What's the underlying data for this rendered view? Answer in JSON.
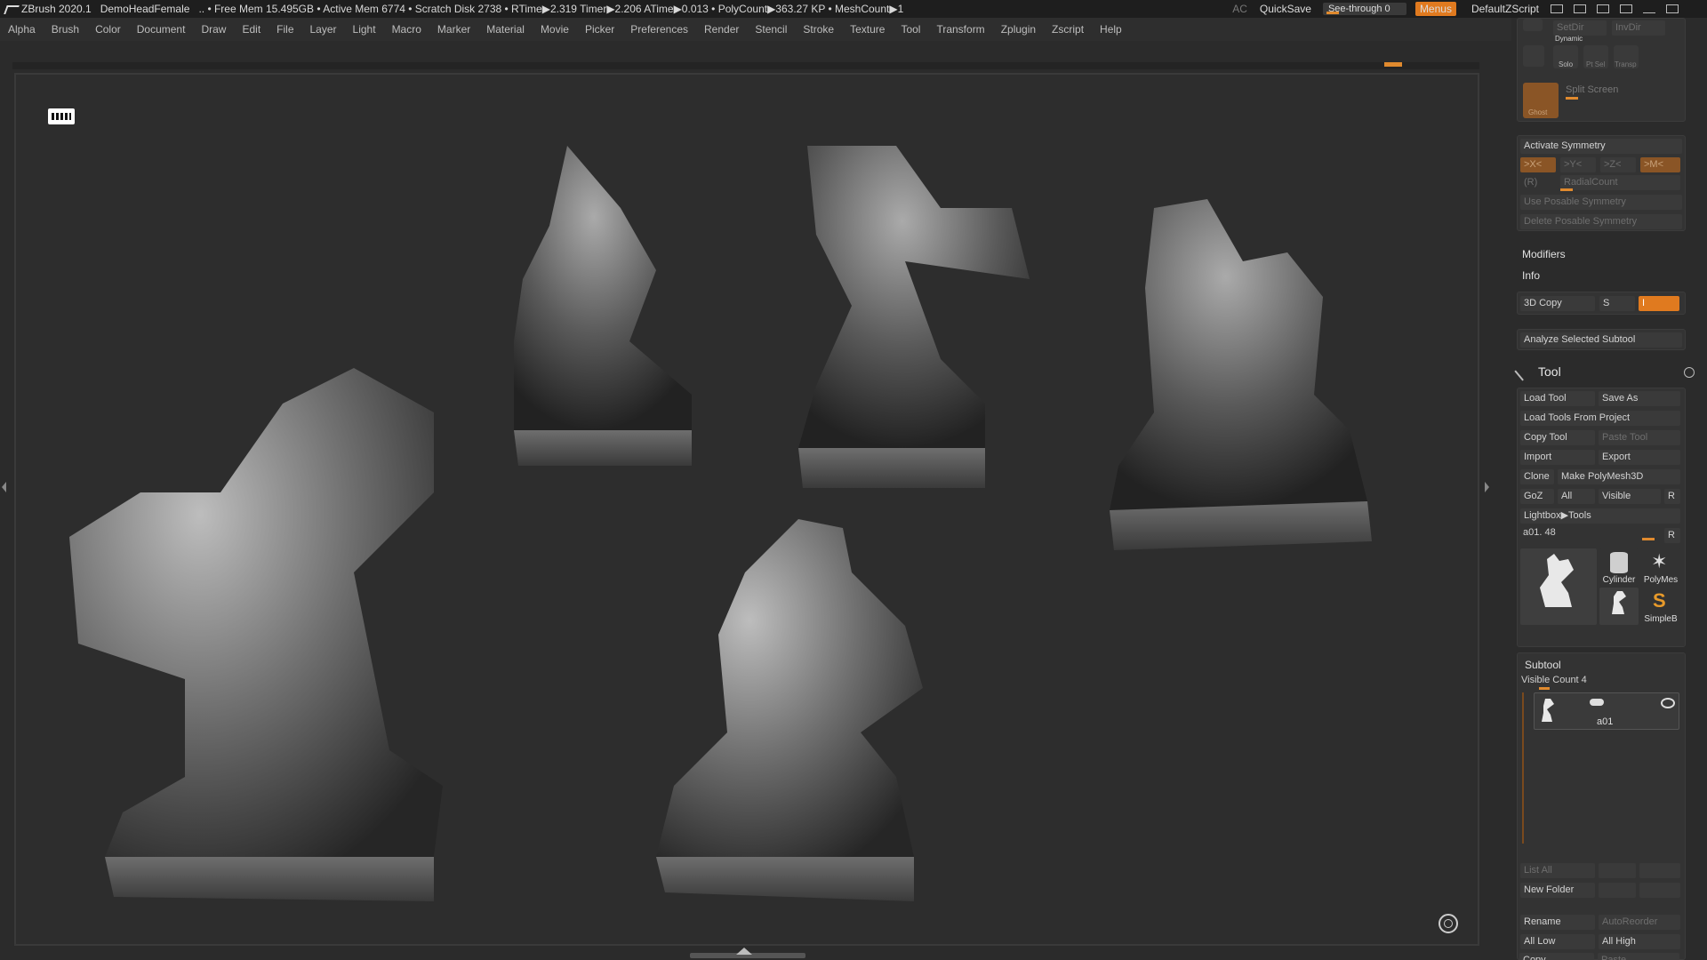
{
  "titlebar": {
    "app": "ZBrush 2020.1",
    "project": "DemoHeadFemale",
    "stats": "..  • Free Mem 15.495GB • Active Mem 6774 • Scratch Disk 2738 •  RTime▶2.319 Timer▶2.206 ATime▶0.013 • PolyCount▶363.27 KP  • MeshCount▶1",
    "ac": "AC",
    "quicksave": "QuickSave",
    "see_through": "See-through   0",
    "menus": "Menus",
    "default_zscript": "DefaultZScript"
  },
  "menubar": [
    "Alpha",
    "Brush",
    "Color",
    "Document",
    "Draw",
    "Edit",
    "File",
    "Layer",
    "Light",
    "Macro",
    "Marker",
    "Material",
    "Movie",
    "Picker",
    "Preferences",
    "Render",
    "Stencil",
    "Stroke",
    "Texture",
    "Tool",
    "Transform",
    "Zplugin",
    "Zscript",
    "Help"
  ],
  "panel": {
    "setdir": "SetDir",
    "invdir": "InvDir",
    "dynamic": "Dynamic",
    "solo": "Solo",
    "ptsel": "Pt Sel",
    "transp": "Transp",
    "ghost": "Ghost",
    "split_screen": "Split Screen",
    "activate_symmetry": "Activate Symmetry",
    "sym_x": ">X<",
    "sym_y": ">Y<",
    "sym_z": ">Z<",
    "sym_m": ">M<",
    "sym_r": "(R)",
    "radial_count": "RadialCount",
    "use_posable": "Use Posable Symmetry",
    "delete_posable": "Delete Posable Symmetry",
    "modifiers": "Modifiers",
    "info": "Info",
    "copy3d": "3D Copy",
    "copy3d_s": "S",
    "copy3d_i": "I",
    "analyze": "Analyze Selected Subtool",
    "tool_title": "Tool",
    "load_tool": "Load Tool",
    "save_as": "Save As",
    "load_from_project": "Load Tools From Project",
    "copy_tool": "Copy Tool",
    "paste_tool": "Paste Tool",
    "import": "Import",
    "export": "Export",
    "clone": "Clone",
    "make_polymesh": "Make PolyMesh3D",
    "goz": "GoZ",
    "all": "All",
    "visible": "Visible",
    "r": "R",
    "lightbox_tools": "Lightbox▶Tools",
    "tool_name": "a01. 48",
    "thumbs": {
      "main": "a01",
      "cylinder": "Cylinder",
      "polymesh": "PolyMes",
      "a01_small": "a01",
      "simpleb": "SimpleB"
    },
    "subtool": "Subtool",
    "visible_count": "Visible Count 4",
    "subtool_item": "a01",
    "list_all": "List All",
    "new_folder": "New Folder",
    "rename": "Rename",
    "auto_reorder": "AutoReorder",
    "all_low": "All Low",
    "all_high": "All High",
    "copy": "Copy",
    "paste": "Paste"
  }
}
